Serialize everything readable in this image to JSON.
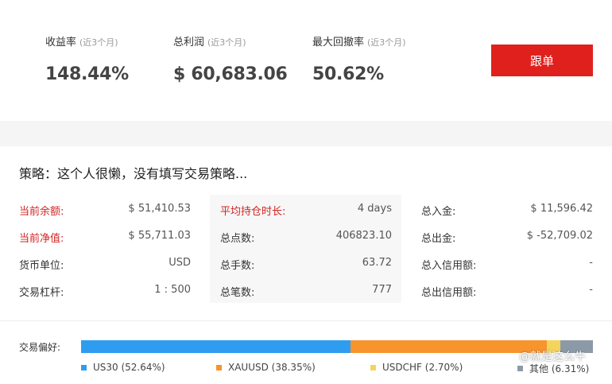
{
  "metrics": [
    {
      "label": "收益率",
      "sub": "(近3个月)",
      "value": "148.44%"
    },
    {
      "label": "总利润",
      "sub": "(近3个月)",
      "value": "$ 60,683.06"
    },
    {
      "label": "最大回撤率",
      "sub": "(近3个月)",
      "value": "50.62%"
    }
  ],
  "follow_button": "跟单",
  "strategy": "策略：这个人很懒，没有填写交易策略...",
  "col1": [
    {
      "key": "当前余额:",
      "value": "$ 51,410.53"
    },
    {
      "key": "当前净值:",
      "value": "$ 55,711.03"
    },
    {
      "key": "货币单位:",
      "value": "USD"
    },
    {
      "key": "交易杠杆:",
      "value": "1 : 500"
    }
  ],
  "col2": [
    {
      "key": "平均持仓时长:",
      "value": "4 days"
    },
    {
      "key": "总点数:",
      "value": "406823.10"
    },
    {
      "key": "总手数:",
      "value": "63.72"
    },
    {
      "key": "总笔数:",
      "value": "777"
    }
  ],
  "col3": [
    {
      "key": "总入金:",
      "value": "$ 11,596.42"
    },
    {
      "key": "总出金:",
      "value": "$ -52,709.02"
    },
    {
      "key": "总入信用额:",
      "value": "-"
    },
    {
      "key": "总出信用额:",
      "value": "-"
    }
  ],
  "preference": {
    "label": "交易偏好:",
    "items": [
      {
        "name": "US30 (52.64%)",
        "percent": 52.64,
        "color": "#2e9df0"
      },
      {
        "name": "XAUUSD (38.35%)",
        "percent": 38.35,
        "color": "#f7942c"
      },
      {
        "name": "USDCHF (2.70%)",
        "percent": 2.7,
        "color": "#f5d45c"
      },
      {
        "name": "其他 (6.31%)",
        "percent": 6.31,
        "color": "#8c9aa8"
      }
    ]
  },
  "watermark": "@就是这么牛",
  "colors": {
    "accent": "#e0201d",
    "highlight_label": "#d02626"
  }
}
